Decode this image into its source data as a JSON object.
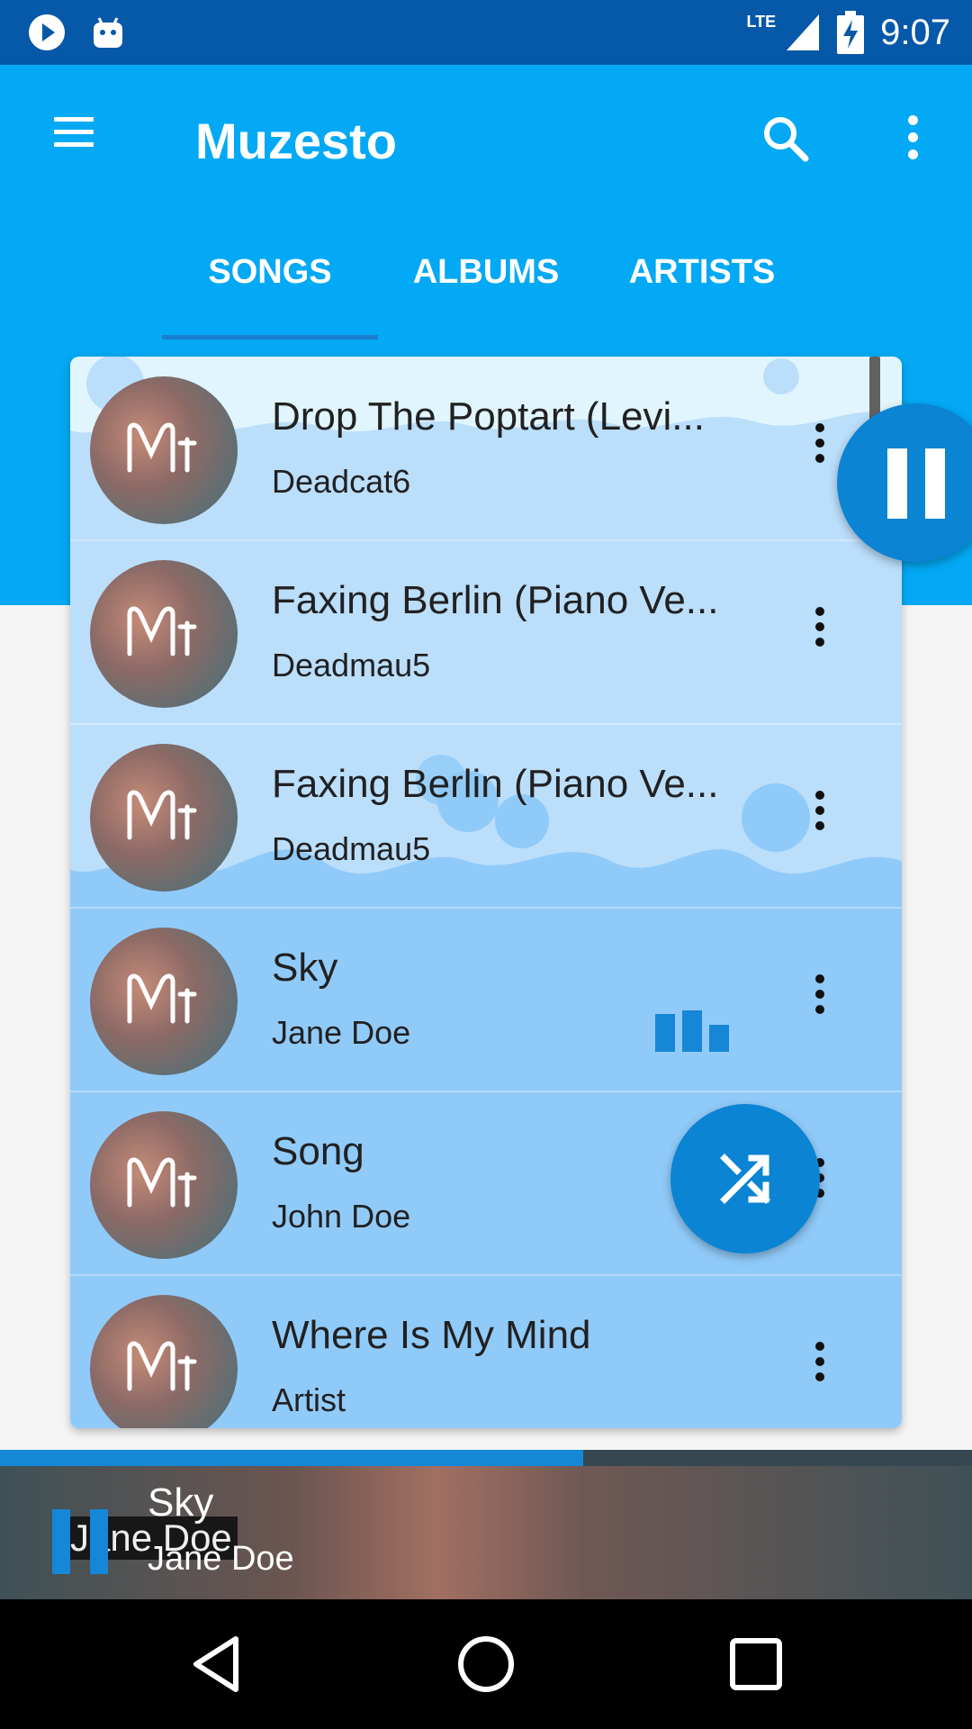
{
  "status_bar": {
    "time": "9:07",
    "network": "LTE",
    "icons": [
      "play-notification-icon",
      "android-icon",
      "signal-icon",
      "battery-charging-icon"
    ]
  },
  "app_bar": {
    "title": "Muzesto",
    "icons": [
      "menu-icon",
      "search-icon",
      "more-vert-icon"
    ]
  },
  "tabs": [
    {
      "label": "SONGS",
      "active": true
    },
    {
      "label": "ALBUMS",
      "active": false
    },
    {
      "label": "ARTISTS",
      "active": false
    }
  ],
  "songs": [
    {
      "title": "Drop The Poptart (Levi...",
      "artist": "Deadcat6"
    },
    {
      "title": "Faxing Berlin (Piano Ve...",
      "artist": "Deadmau5"
    },
    {
      "title": "Faxing Berlin (Piano Ve...",
      "artist": "Deadmau5"
    },
    {
      "title": "Sky",
      "artist": "Jane Doe",
      "now_playing": true
    },
    {
      "title": "Song",
      "artist": "John Doe"
    },
    {
      "title": "Where Is My Mind",
      "artist": "Artist"
    }
  ],
  "now_playing": {
    "title": "Sky",
    "artist": "Jane Doe",
    "ghost_artist": "Jane Doe",
    "progress": 0.6
  },
  "colors": {
    "status_bar": "#0658a8",
    "primary": "#03a9f4",
    "accent": "#0b84d4",
    "list_bg": "#90caf9"
  }
}
